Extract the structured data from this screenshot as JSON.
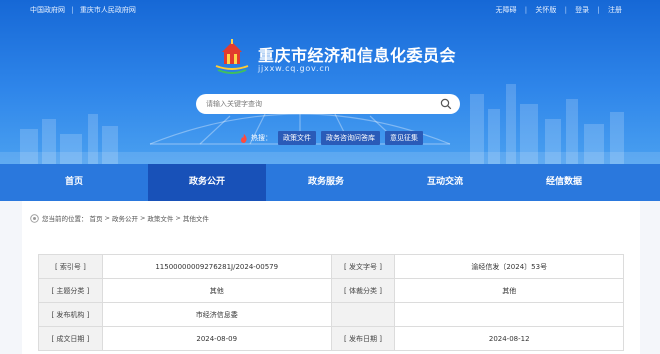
{
  "topbar": {
    "links_left": [
      "中国政府网",
      "重庆市人民政府网"
    ],
    "links_right": [
      "无障碍",
      "关怀版",
      "登录",
      "注册"
    ]
  },
  "header": {
    "title": "重庆市经济和信息化委员会",
    "domain": "jjxxw.cq.gov.cn"
  },
  "search": {
    "placeholder": "请输入关键字查询"
  },
  "hot": {
    "label": "热搜：",
    "tags": [
      "政策文件",
      "政务咨询问答库",
      "意见征集"
    ]
  },
  "nav": {
    "items": [
      "首页",
      "政务公开",
      "政务服务",
      "互动交流",
      "经信数据"
    ],
    "active_index": 1
  },
  "breadcrumb": {
    "prefix": "您当前的位置：",
    "items": [
      "首页",
      "政务公开",
      "政策文件",
      "其他文件"
    ],
    "separator": ">"
  },
  "meta_table": {
    "rows": [
      {
        "label1": "[ 索引号 ]",
        "value1": "11500000009276281J/2024-00579",
        "label2": "[ 发文字号 ]",
        "value2": "渝经信发〔2024〕53号"
      },
      {
        "label1": "[ 主题分类 ]",
        "value1": "其他",
        "label2": "[ 体裁分类 ]",
        "value2": "其他"
      },
      {
        "label1": "[ 发布机构 ]",
        "value1": "市经济信息委",
        "label2": "",
        "value2": ""
      },
      {
        "label1": "[ 成文日期 ]",
        "value1": "2024-08-09",
        "label2": "[ 发布日期 ]",
        "value2": "2024-08-12"
      }
    ]
  },
  "colors": {
    "hero_top": "#1668d6",
    "nav_bg": "#2a78dd",
    "nav_active": "#1851b8",
    "hot_tag_bg": "#2a5bb8"
  }
}
